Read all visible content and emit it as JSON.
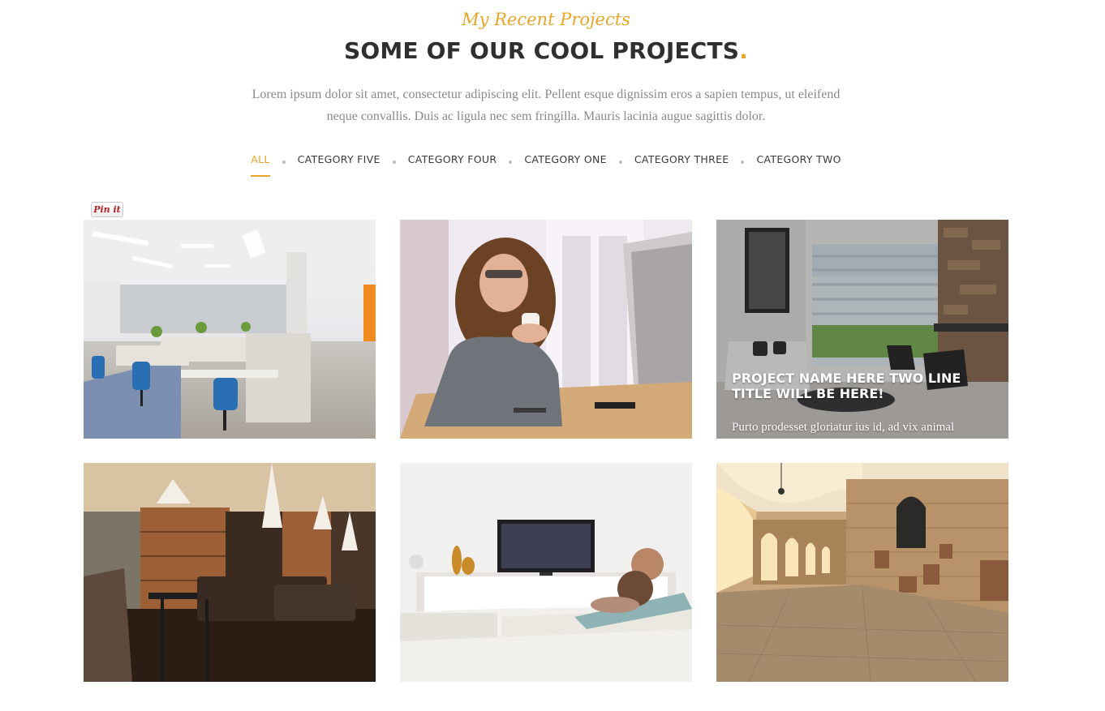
{
  "section": {
    "subtitle": "My Recent Projects",
    "title": "SOME OF OUR COOL PROJECTS",
    "title_accent": ".",
    "description_line1": "Lorem ipsum dolor sit amet, consectetur adipiscing elit. Pellent esque dignissim eros a sapien tempus, ut eleifend",
    "description_line2": "neque convallis. Duis ac ligula nec sem fringilla. Mauris lacinia augue sagittis dolor."
  },
  "filters": [
    {
      "label": "ALL",
      "active": true
    },
    {
      "label": "CATEGORY FIVE",
      "active": false
    },
    {
      "label": "CATEGORY FOUR",
      "active": false
    },
    {
      "label": "CATEGORY ONE",
      "active": false
    },
    {
      "label": "CATEGORY THREE",
      "active": false
    },
    {
      "label": "CATEGORY TWO",
      "active": false
    }
  ],
  "pinit": {
    "label": "Pin it"
  },
  "projects": [
    {
      "image": "office-cubicles-photo"
    },
    {
      "image": "woman-with-coffee-photo"
    },
    {
      "image": "living-room-photo",
      "hover_title": "PROJECT NAME HERE TWO LINE TITLE WILL BE HERE!",
      "hover_text": "Purto prodesset gloriatur ius id, ad vix animal"
    },
    {
      "image": "restaurant-interior-photo"
    },
    {
      "image": "couple-on-sofa-photo"
    },
    {
      "image": "cloister-arches-photo"
    }
  ],
  "colors": {
    "accent": "#e8a628",
    "heading": "#2f2f2f",
    "body_text": "#8a8a8a"
  }
}
